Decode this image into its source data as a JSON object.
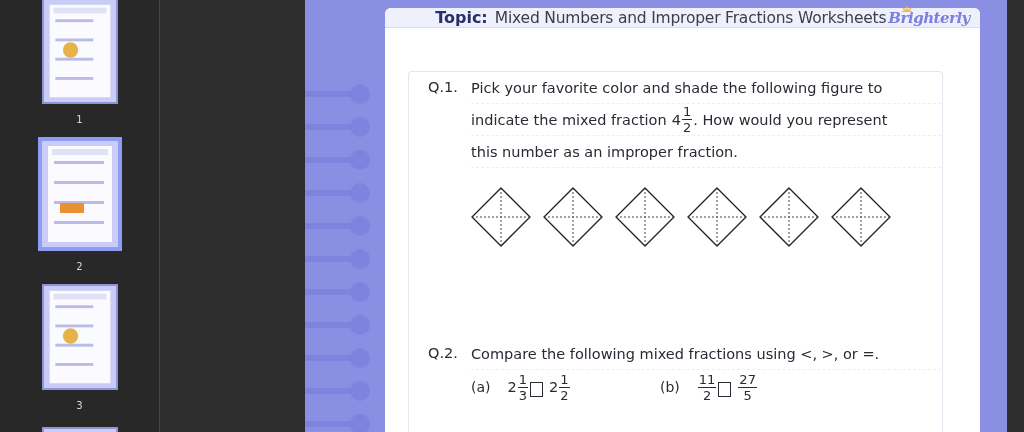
{
  "thumbnails": [
    {
      "label": "1",
      "selected": false
    },
    {
      "label": "2",
      "selected": true
    },
    {
      "label": "3",
      "selected": false
    },
    {
      "selected": false
    }
  ],
  "worksheet": {
    "header": {
      "topic_label": "Topic:",
      "title": "Mixed Numbers and Improper Fractions Worksheets",
      "logo": "Brighterly"
    },
    "questions": [
      {
        "kind": "shade",
        "number": "Q.1.",
        "lines": [
          [
            {
              "kind": "text",
              "text": "Pick your favorite color and shade the following figure to"
            }
          ],
          [
            {
              "kind": "text",
              "text": "indicate the mixed fraction"
            },
            {
              "kind": "fraction",
              "whole": "4",
              "num": "1",
              "den": "2"
            },
            {
              "kind": "text",
              "text": ". How would you represent"
            }
          ],
          [
            {
              "kind": "text",
              "text": "this number as an improper fraction."
            }
          ]
        ],
        "figures": [
          {
            "kind": "diamond"
          },
          {
            "kind": "diamond"
          },
          {
            "kind": "diamond"
          },
          {
            "kind": "diamond"
          },
          {
            "kind": "diamond"
          },
          {
            "kind": "diamond"
          }
        ]
      },
      {
        "kind": "compare",
        "number": "Q.2.",
        "lines": [
          [
            {
              "kind": "text",
              "text": "Compare the following mixed fractions using <, >, or =."
            }
          ]
        ],
        "parts": [
          {
            "label": "(a)",
            "terms": [
              {
                "kind": "fraction",
                "whole": "2",
                "num": "1",
                "den": "3"
              },
              {
                "kind": "blank"
              },
              {
                "kind": "fraction",
                "whole": "2",
                "num": "1",
                "den": "2"
              }
            ]
          },
          {
            "label": "(b)",
            "terms": [
              {
                "kind": "fraction",
                "num": "11",
                "den": "2"
              },
              {
                "kind": "blank"
              },
              {
                "kind": "fraction",
                "num": "27",
                "den": "5"
              }
            ]
          }
        ]
      }
    ]
  }
}
